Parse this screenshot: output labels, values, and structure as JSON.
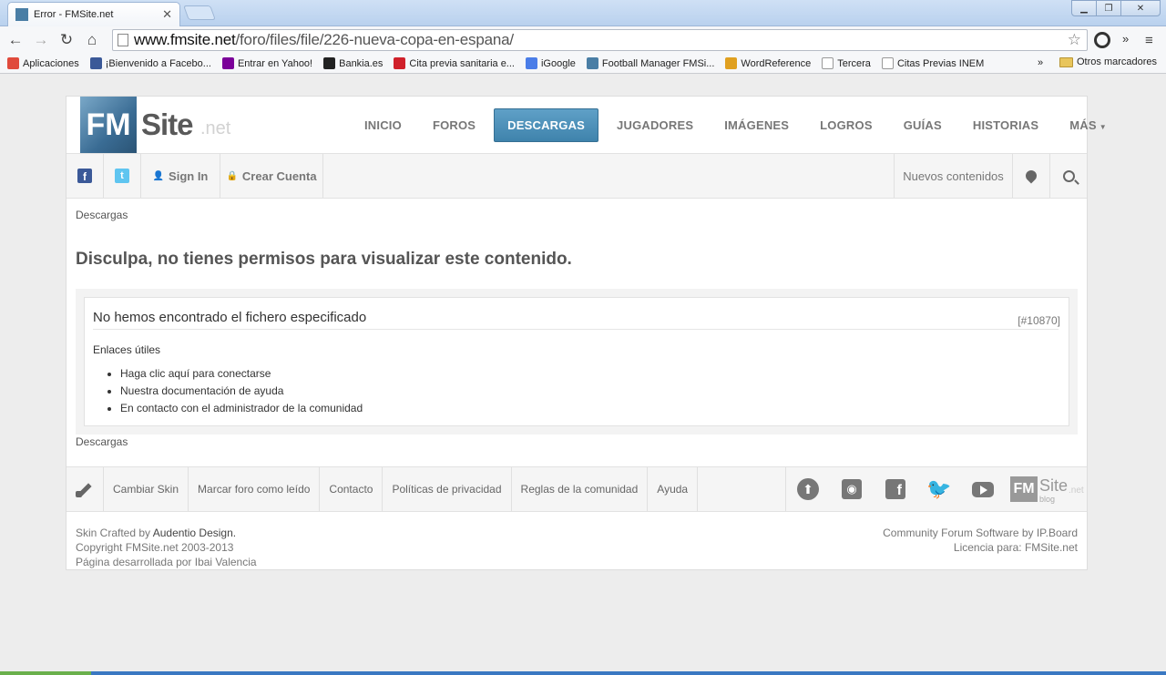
{
  "browser": {
    "tab_title": "Error - FMSite.net",
    "url_domain": "www.fmsite.net",
    "url_path": "/foro/files/file/226-nueva-copa-en-espana/",
    "bookmarks": [
      {
        "label": "Aplicaciones",
        "icon": "apps-grid-icon",
        "color": "#e04a3c"
      },
      {
        "label": "¡Bienvenido a Facebo...",
        "icon": "facebook-icon",
        "color": "#3b5998"
      },
      {
        "label": "Entrar en Yahoo!",
        "icon": "yahoo-icon",
        "color": "#7b0099"
      },
      {
        "label": "Bankia.es",
        "icon": "bankia-icon",
        "color": "#222222"
      },
      {
        "label": "Cita previa sanitaria e...",
        "icon": "madrid-icon",
        "color": "#d0202a"
      },
      {
        "label": "iGoogle",
        "icon": "google-icon",
        "color": "#4a7de8"
      },
      {
        "label": "Football Manager FMSi...",
        "icon": "fmsite-icon",
        "color": "#4a7ea5"
      },
      {
        "label": "WordReference",
        "icon": "wordreference-icon",
        "color": "#e0a020"
      },
      {
        "label": "Tercera",
        "icon": "page-icon",
        "color": "#ffffff"
      },
      {
        "label": "Citas Previas INEM",
        "icon": "at-icon",
        "color": "#ffffff"
      }
    ],
    "bookmarks_more": "»",
    "other_bookmarks": "Otros marcadores"
  },
  "site": {
    "logo_fm": "FM",
    "logo_site": "Site",
    "logo_net": ".net",
    "nav": [
      "INICIO",
      "FOROS",
      "DESCARGAS",
      "JUGADORES",
      "IMÁGENES",
      "LOGROS",
      "GUÍAS",
      "HISTORIAS",
      "MÁS"
    ],
    "nav_active": "DESCARGAS",
    "userbar": {
      "sign_in": "Sign In",
      "create_account": "Crear Cuenta",
      "new_content": "Nuevos contenidos"
    },
    "breadcrumb": "Descargas",
    "error_title": "Disculpa, no tienes permisos para visualizar este contenido.",
    "error_message": "No hemos encontrado el fichero especificado",
    "error_code": "[#10870]",
    "useful_links_title": "Enlaces útiles",
    "useful_links": [
      "Haga clic aquí para conectarse",
      "Nuestra documentación de ayuda",
      "En contacto con el administrador de la comunidad"
    ],
    "footer_links": [
      "Cambiar Skin",
      "Marcar foro como leído",
      "Contacto",
      "Políticas de privacidad",
      "Reglas de la comunidad",
      "Ayuda"
    ],
    "footer_blog_fm": "FM",
    "footer_blog_site": "Site",
    "footer_blog_net": ".net",
    "footer_blog_label": "blog",
    "copyright_skin_prefix": "Skin Crafted by ",
    "copyright_skin_author": "Audentio Design.",
    "copyright_line2": "Copyright FMSite.net 2003-2013",
    "copyright_line3": "Página desarrollada por Ibai Valencia",
    "software_line": "Community Forum Software by IP.Board",
    "license_line": "Licencia para: FMSite.net"
  },
  "colors": {
    "accent": "#4a8fb8",
    "titlebar": "#c4d8f1"
  }
}
